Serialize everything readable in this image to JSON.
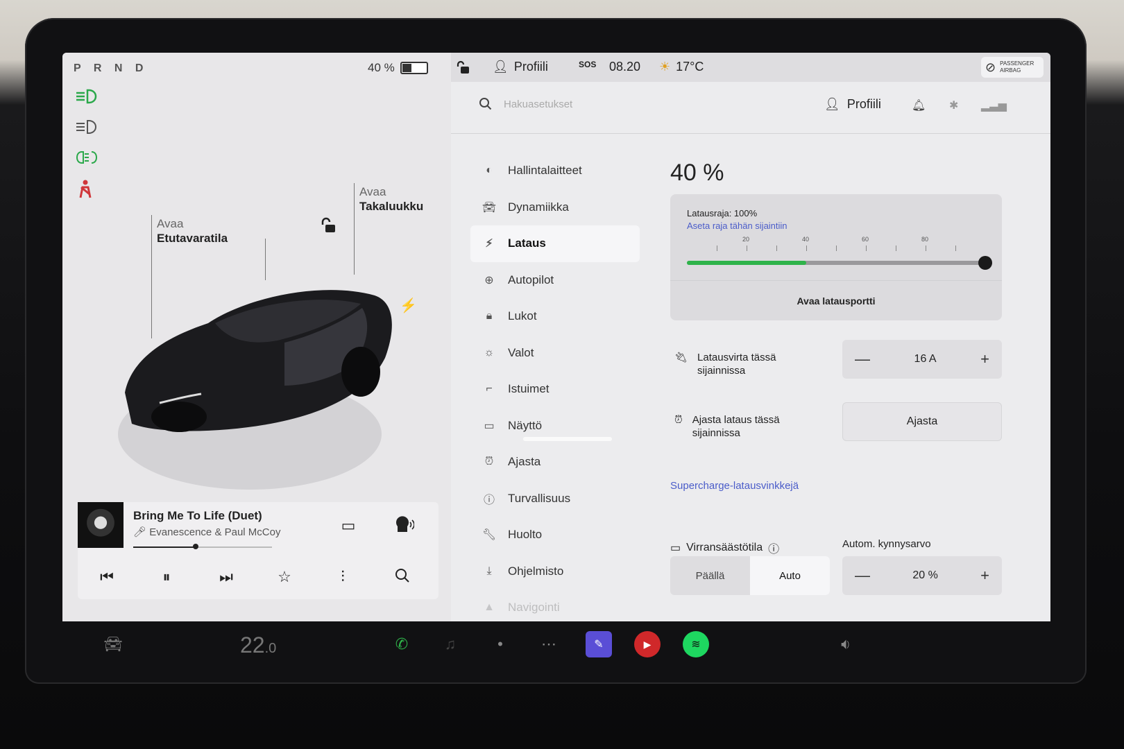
{
  "status": {
    "gear": "P R N D",
    "battery_pct_label": "40 %",
    "battery_level": 0.4,
    "profile": "Profiili",
    "sos": "SOS",
    "time": "08.20",
    "temperature": "17°C",
    "airbag_line1": "PASSENGER",
    "airbag_line2": "AIRBAG"
  },
  "car": {
    "front_trunk_action": "Avaa",
    "front_trunk_label": "Etutavaratila",
    "rear_trunk_action": "Avaa",
    "rear_trunk_label": "Takaluukku"
  },
  "media": {
    "title": "Bring Me To Life (Duet)",
    "artist": "Evanescence & Paul McCoy",
    "progress": 0.45
  },
  "header": {
    "search_placeholder": "Hakuasetukset",
    "profile": "Profiili"
  },
  "nav": [
    {
      "label": "Hallintalaitteet",
      "icon": "toggle-icon"
    },
    {
      "label": "Dynamiikka",
      "icon": "car-icon"
    },
    {
      "label": "Lataus",
      "icon": "bolt-icon"
    },
    {
      "label": "Autopilot",
      "icon": "steering-wheel-icon"
    },
    {
      "label": "Lukot",
      "icon": "lock-icon"
    },
    {
      "label": "Valot",
      "icon": "sun-icon"
    },
    {
      "label": "Istuimet",
      "icon": "seat-icon"
    },
    {
      "label": "Näyttö",
      "icon": "display-icon"
    },
    {
      "label": "Ajasta",
      "icon": "alarm-icon"
    },
    {
      "label": "Turvallisuus",
      "icon": "info-icon"
    },
    {
      "label": "Huolto",
      "icon": "wrench-icon"
    },
    {
      "label": "Ohjelmisto",
      "icon": "download-icon"
    },
    {
      "label": "Navigointi",
      "icon": "navigation-icon"
    }
  ],
  "charging": {
    "percent": "40 %",
    "limit_label": "Latausraja: 100%",
    "set_limit_link": "Aseta raja tähän sijaintiin",
    "ticks": [
      "20",
      "40",
      "60",
      "80"
    ],
    "current_level": 0.4,
    "limit_level": 1.0,
    "open_port": "Avaa latausportti",
    "current_label_1": "Latausvirta tässä",
    "current_label_2": "sijainnissa",
    "current_value": "16 A",
    "schedule_label_1": "Ajasta lataus tässä",
    "schedule_label_2": "sijainnissa",
    "schedule_button": "Ajasta",
    "supercharge_link": "Supercharge-latausvinkkejä",
    "power_saving": "Virransäästötila",
    "threshold_label": "Autom. kynnysarvo",
    "seg_on": "Päällä",
    "seg_auto": "Auto",
    "threshold_value": "20 %"
  },
  "dock": {
    "temperature": "22.0",
    "temperature_int": "22",
    "temperature_dec": ".0"
  },
  "colors": {
    "accent_link": "#4a5cc9",
    "charge_green": "#2fb34a",
    "indicator_green": "#2aa84a",
    "seatbelt_red": "#d0363a"
  }
}
